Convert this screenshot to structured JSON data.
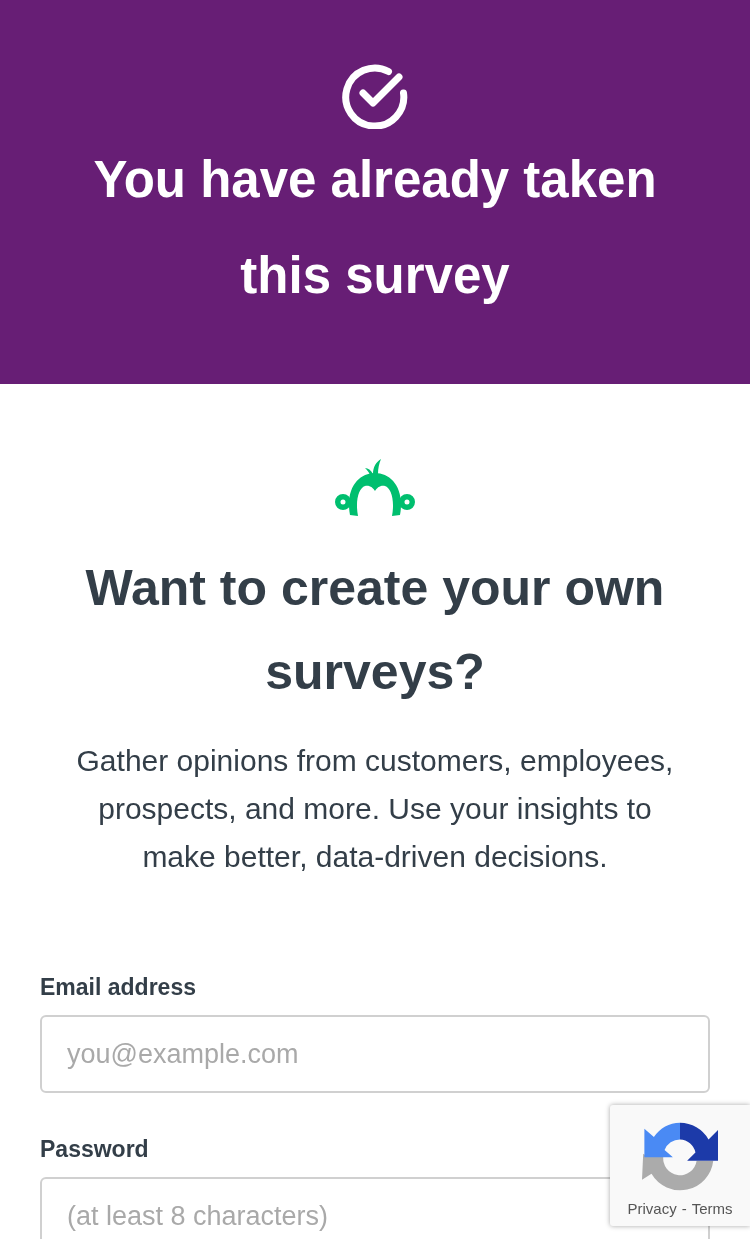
{
  "banner": {
    "title": "You have already taken this survey"
  },
  "promo": {
    "heading": "Want to create your own surveys?",
    "text": "Gather opinions from customers, employees, prospects, and more. Use your insights to make better, data-driven decisions."
  },
  "form": {
    "fields": [
      {
        "label": "Email address",
        "placeholder": "you@example.com"
      },
      {
        "label": "Password",
        "placeholder": "(at least 8 characters)"
      }
    ]
  },
  "captcha_badge": {
    "links": [
      {
        "label": "Privacy"
      },
      {
        "label": "Terms"
      }
    ],
    "separator": "-"
  }
}
